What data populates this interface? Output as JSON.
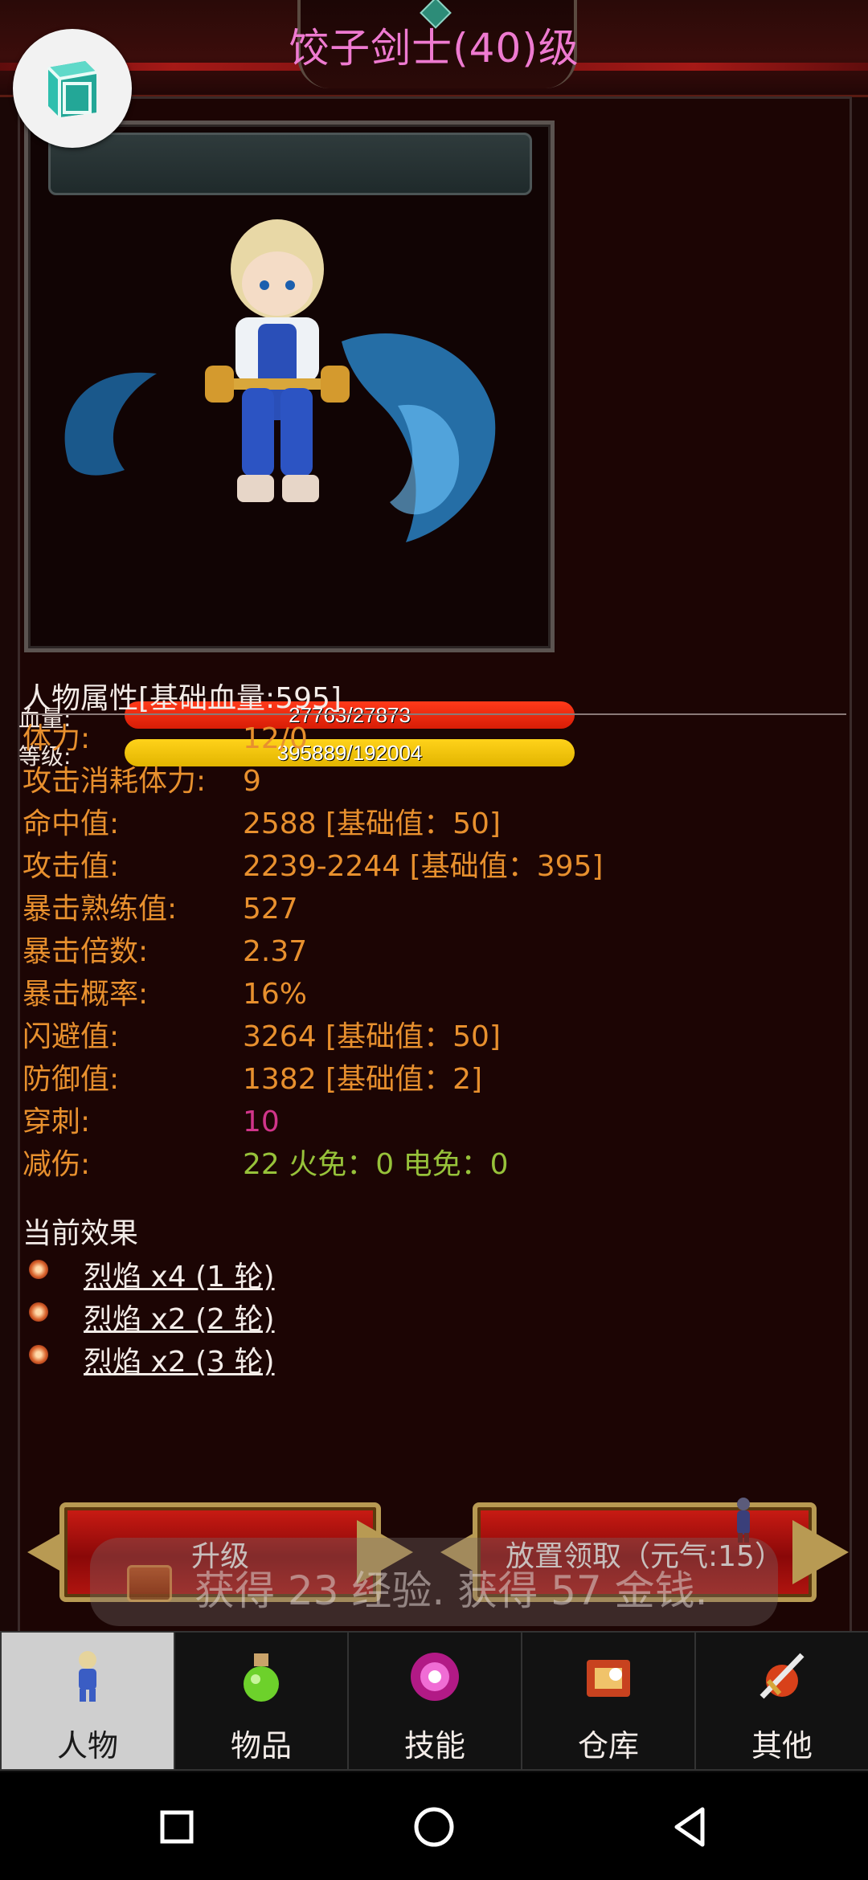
{
  "header": {
    "title": "饺子剑士(40)级"
  },
  "stats_bars": {
    "hp_label": "血量:",
    "hp_value": "27763/27873",
    "hp_fraction": 0.996,
    "level_label": "等级:",
    "level_value": "395889/192004",
    "level_fraction": 1.0
  },
  "attributes": {
    "heading": "人物属性[基础血量:595]",
    "rows": [
      {
        "key": "体力:",
        "value": "12/0"
      },
      {
        "key": "攻击消耗体力:",
        "value": "9"
      },
      {
        "key": "命中值:",
        "value": "2588 [基础值：50]"
      },
      {
        "key": "攻击值:",
        "value": "2239-2244 [基础值：395]"
      },
      {
        "key": "暴击熟练值:",
        "value": "527"
      },
      {
        "key": "暴击倍数:",
        "value": "2.37"
      },
      {
        "key": "暴击概率:",
        "value": "16%"
      },
      {
        "key": "闪避值:",
        "value": "3264 [基础值：50]"
      },
      {
        "key": "防御值:",
        "value": "1382 [基础值：2]"
      },
      {
        "key": "穿刺:",
        "value": "10"
      },
      {
        "key": "减伤:",
        "value": "22 火免：0 电免：0"
      }
    ]
  },
  "effects": {
    "heading": "当前效果",
    "items": [
      "烈焰 x4 (1 轮)",
      "烈焰 x2 (2 轮)",
      "烈焰 x2 (3 轮)"
    ]
  },
  "actions": {
    "upgrade_label": "升级",
    "collect_label": "放置领取（元气:15）"
  },
  "toast": {
    "message": "获得 23 经验. 获得 57 金钱."
  },
  "tabs": [
    {
      "label": "人物",
      "icon": "character-icon",
      "active": true
    },
    {
      "label": "物品",
      "icon": "potion-icon",
      "active": false
    },
    {
      "label": "技能",
      "icon": "skill-orb-icon",
      "active": false
    },
    {
      "label": "仓库",
      "icon": "warehouse-icon",
      "active": false
    },
    {
      "label": "其他",
      "icon": "sword-icon",
      "active": false
    }
  ],
  "colors": {
    "title": "#ee7ad0",
    "attr_text": "#e8902e",
    "pierce": "#d1358a",
    "reduction": "#97c23a",
    "hp_bar": "#e4240c",
    "level_bar": "#f2c000"
  }
}
